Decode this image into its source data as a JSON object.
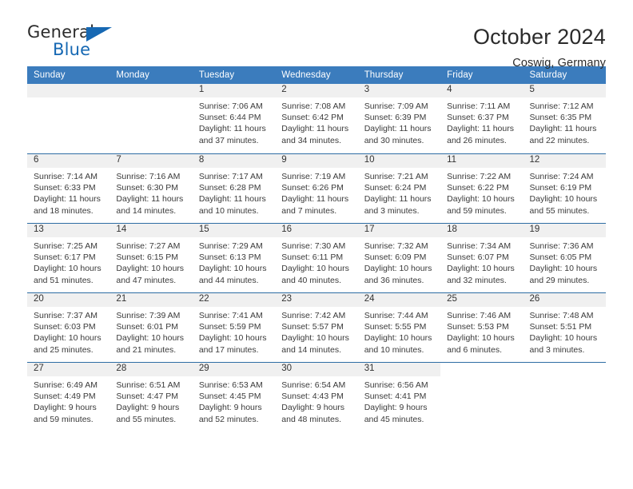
{
  "logo": {
    "word1": "General",
    "word2": "Blue",
    "triangle_color": "#1668b3"
  },
  "header": {
    "title": "October 2024",
    "subtitle": "Coswig, Germany"
  },
  "theme": {
    "header_blue": "#3b7cbd",
    "rule_blue": "#2e6da4",
    "daynum_band": "#f0f0f0"
  },
  "calendar": {
    "weekdays": [
      "Sunday",
      "Monday",
      "Tuesday",
      "Wednesday",
      "Thursday",
      "Friday",
      "Saturday"
    ],
    "weeks": [
      [
        {
          "day": "",
          "lines": [],
          "state": "empty"
        },
        {
          "day": "",
          "lines": [],
          "state": "empty"
        },
        {
          "day": "1",
          "lines": [
            "Sunrise: 7:06 AM",
            "Sunset: 6:44 PM",
            "Daylight: 11 hours",
            "and 37 minutes."
          ],
          "state": "filled"
        },
        {
          "day": "2",
          "lines": [
            "Sunrise: 7:08 AM",
            "Sunset: 6:42 PM",
            "Daylight: 11 hours",
            "and 34 minutes."
          ],
          "state": "filled"
        },
        {
          "day": "3",
          "lines": [
            "Sunrise: 7:09 AM",
            "Sunset: 6:39 PM",
            "Daylight: 11 hours",
            "and 30 minutes."
          ],
          "state": "filled"
        },
        {
          "day": "4",
          "lines": [
            "Sunrise: 7:11 AM",
            "Sunset: 6:37 PM",
            "Daylight: 11 hours",
            "and 26 minutes."
          ],
          "state": "filled"
        },
        {
          "day": "5",
          "lines": [
            "Sunrise: 7:12 AM",
            "Sunset: 6:35 PM",
            "Daylight: 11 hours",
            "and 22 minutes."
          ],
          "state": "filled"
        }
      ],
      [
        {
          "day": "6",
          "lines": [
            "Sunrise: 7:14 AM",
            "Sunset: 6:33 PM",
            "Daylight: 11 hours",
            "and 18 minutes."
          ],
          "state": "filled"
        },
        {
          "day": "7",
          "lines": [
            "Sunrise: 7:16 AM",
            "Sunset: 6:30 PM",
            "Daylight: 11 hours",
            "and 14 minutes."
          ],
          "state": "filled"
        },
        {
          "day": "8",
          "lines": [
            "Sunrise: 7:17 AM",
            "Sunset: 6:28 PM",
            "Daylight: 11 hours",
            "and 10 minutes."
          ],
          "state": "filled"
        },
        {
          "day": "9",
          "lines": [
            "Sunrise: 7:19 AM",
            "Sunset: 6:26 PM",
            "Daylight: 11 hours",
            "and 7 minutes."
          ],
          "state": "filled"
        },
        {
          "day": "10",
          "lines": [
            "Sunrise: 7:21 AM",
            "Sunset: 6:24 PM",
            "Daylight: 11 hours",
            "and 3 minutes."
          ],
          "state": "filled"
        },
        {
          "day": "11",
          "lines": [
            "Sunrise: 7:22 AM",
            "Sunset: 6:22 PM",
            "Daylight: 10 hours",
            "and 59 minutes."
          ],
          "state": "filled"
        },
        {
          "day": "12",
          "lines": [
            "Sunrise: 7:24 AM",
            "Sunset: 6:19 PM",
            "Daylight: 10 hours",
            "and 55 minutes."
          ],
          "state": "filled"
        }
      ],
      [
        {
          "day": "13",
          "lines": [
            "Sunrise: 7:25 AM",
            "Sunset: 6:17 PM",
            "Daylight: 10 hours",
            "and 51 minutes."
          ],
          "state": "filled"
        },
        {
          "day": "14",
          "lines": [
            "Sunrise: 7:27 AM",
            "Sunset: 6:15 PM",
            "Daylight: 10 hours",
            "and 47 minutes."
          ],
          "state": "filled"
        },
        {
          "day": "15",
          "lines": [
            "Sunrise: 7:29 AM",
            "Sunset: 6:13 PM",
            "Daylight: 10 hours",
            "and 44 minutes."
          ],
          "state": "filled"
        },
        {
          "day": "16",
          "lines": [
            "Sunrise: 7:30 AM",
            "Sunset: 6:11 PM",
            "Daylight: 10 hours",
            "and 40 minutes."
          ],
          "state": "filled"
        },
        {
          "day": "17",
          "lines": [
            "Sunrise: 7:32 AM",
            "Sunset: 6:09 PM",
            "Daylight: 10 hours",
            "and 36 minutes."
          ],
          "state": "filled"
        },
        {
          "day": "18",
          "lines": [
            "Sunrise: 7:34 AM",
            "Sunset: 6:07 PM",
            "Daylight: 10 hours",
            "and 32 minutes."
          ],
          "state": "filled"
        },
        {
          "day": "19",
          "lines": [
            "Sunrise: 7:36 AM",
            "Sunset: 6:05 PM",
            "Daylight: 10 hours",
            "and 29 minutes."
          ],
          "state": "filled"
        }
      ],
      [
        {
          "day": "20",
          "lines": [
            "Sunrise: 7:37 AM",
            "Sunset: 6:03 PM",
            "Daylight: 10 hours",
            "and 25 minutes."
          ],
          "state": "filled"
        },
        {
          "day": "21",
          "lines": [
            "Sunrise: 7:39 AM",
            "Sunset: 6:01 PM",
            "Daylight: 10 hours",
            "and 21 minutes."
          ],
          "state": "filled"
        },
        {
          "day": "22",
          "lines": [
            "Sunrise: 7:41 AM",
            "Sunset: 5:59 PM",
            "Daylight: 10 hours",
            "and 17 minutes."
          ],
          "state": "filled"
        },
        {
          "day": "23",
          "lines": [
            "Sunrise: 7:42 AM",
            "Sunset: 5:57 PM",
            "Daylight: 10 hours",
            "and 14 minutes."
          ],
          "state": "filled"
        },
        {
          "day": "24",
          "lines": [
            "Sunrise: 7:44 AM",
            "Sunset: 5:55 PM",
            "Daylight: 10 hours",
            "and 10 minutes."
          ],
          "state": "filled"
        },
        {
          "day": "25",
          "lines": [
            "Sunrise: 7:46 AM",
            "Sunset: 5:53 PM",
            "Daylight: 10 hours",
            "and 6 minutes."
          ],
          "state": "filled"
        },
        {
          "day": "26",
          "lines": [
            "Sunrise: 7:48 AM",
            "Sunset: 5:51 PM",
            "Daylight: 10 hours",
            "and 3 minutes."
          ],
          "state": "filled"
        }
      ],
      [
        {
          "day": "27",
          "lines": [
            "Sunrise: 6:49 AM",
            "Sunset: 4:49 PM",
            "Daylight: 9 hours",
            "and 59 minutes."
          ],
          "state": "filled"
        },
        {
          "day": "28",
          "lines": [
            "Sunrise: 6:51 AM",
            "Sunset: 4:47 PM",
            "Daylight: 9 hours",
            "and 55 minutes."
          ],
          "state": "filled"
        },
        {
          "day": "29",
          "lines": [
            "Sunrise: 6:53 AM",
            "Sunset: 4:45 PM",
            "Daylight: 9 hours",
            "and 52 minutes."
          ],
          "state": "filled"
        },
        {
          "day": "30",
          "lines": [
            "Sunrise: 6:54 AM",
            "Sunset: 4:43 PM",
            "Daylight: 9 hours",
            "and 48 minutes."
          ],
          "state": "filled"
        },
        {
          "day": "31",
          "lines": [
            "Sunrise: 6:56 AM",
            "Sunset: 4:41 PM",
            "Daylight: 9 hours",
            "and 45 minutes."
          ],
          "state": "filled"
        },
        {
          "day": "",
          "lines": [],
          "state": "blank"
        },
        {
          "day": "",
          "lines": [],
          "state": "blank"
        }
      ]
    ]
  }
}
